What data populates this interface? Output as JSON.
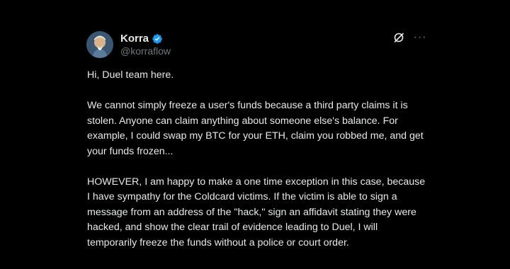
{
  "author": {
    "display_name": "Korra",
    "handle": "@korraflow",
    "verified": true,
    "avatar_icon": "avatar-image"
  },
  "actions": {
    "grok_icon": "grok-icon",
    "more_icon": "more-icon",
    "more_label": "···"
  },
  "tweet": {
    "paragraphs": [
      "Hi, Duel team here.",
      "We cannot simply freeze a user's funds because a third party claims it is stolen. Anyone can claim anything about someone else's balance. For example, I could swap my BTC for your ETH, claim you robbed me, and get your funds frozen...",
      "HOWEVER, I am happy to make a one time exception in this case, because I have sympathy for the Coldcard victims. If the victim is able to sign a message from an address of the \"hack,\" sign an affidavit stating they were hacked, and show the clear trail of evidence leading to Duel, I will temporarily freeze the funds without a police or court order."
    ]
  },
  "colors": {
    "background": "#000000",
    "text": "#e7e9ea",
    "secondary": "#71767b",
    "verified": "#1d9bf0"
  }
}
